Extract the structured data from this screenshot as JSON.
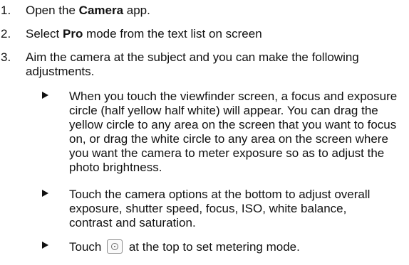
{
  "steps": [
    {
      "number": "1.",
      "pre": "Open the ",
      "bold": "Camera",
      "post": " app."
    },
    {
      "number": "2.",
      "pre": "Select ",
      "bold": "Pro",
      "post": " mode from the text list on screen"
    },
    {
      "number": "3.",
      "text": "Aim the camera at the subject and you can make the following adjustments."
    }
  ],
  "bullets": [
    {
      "text": "When you touch the viewfinder screen, a focus and exposure circle (half yellow half white) will appear. You can drag the yellow circle to any area on the screen that you want to focus on, or drag the white circle to any area on the screen where you want the camera to meter exposure so as to adjust the photo brightness."
    },
    {
      "text": "Touch the camera options at the bottom to adjust overall exposure, shutter speed, focus, ISO, white balance, contrast and saturation."
    },
    {
      "pre": "Touch ",
      "icon": "metering-mode-icon",
      "post": " at the top to set metering mode."
    }
  ]
}
